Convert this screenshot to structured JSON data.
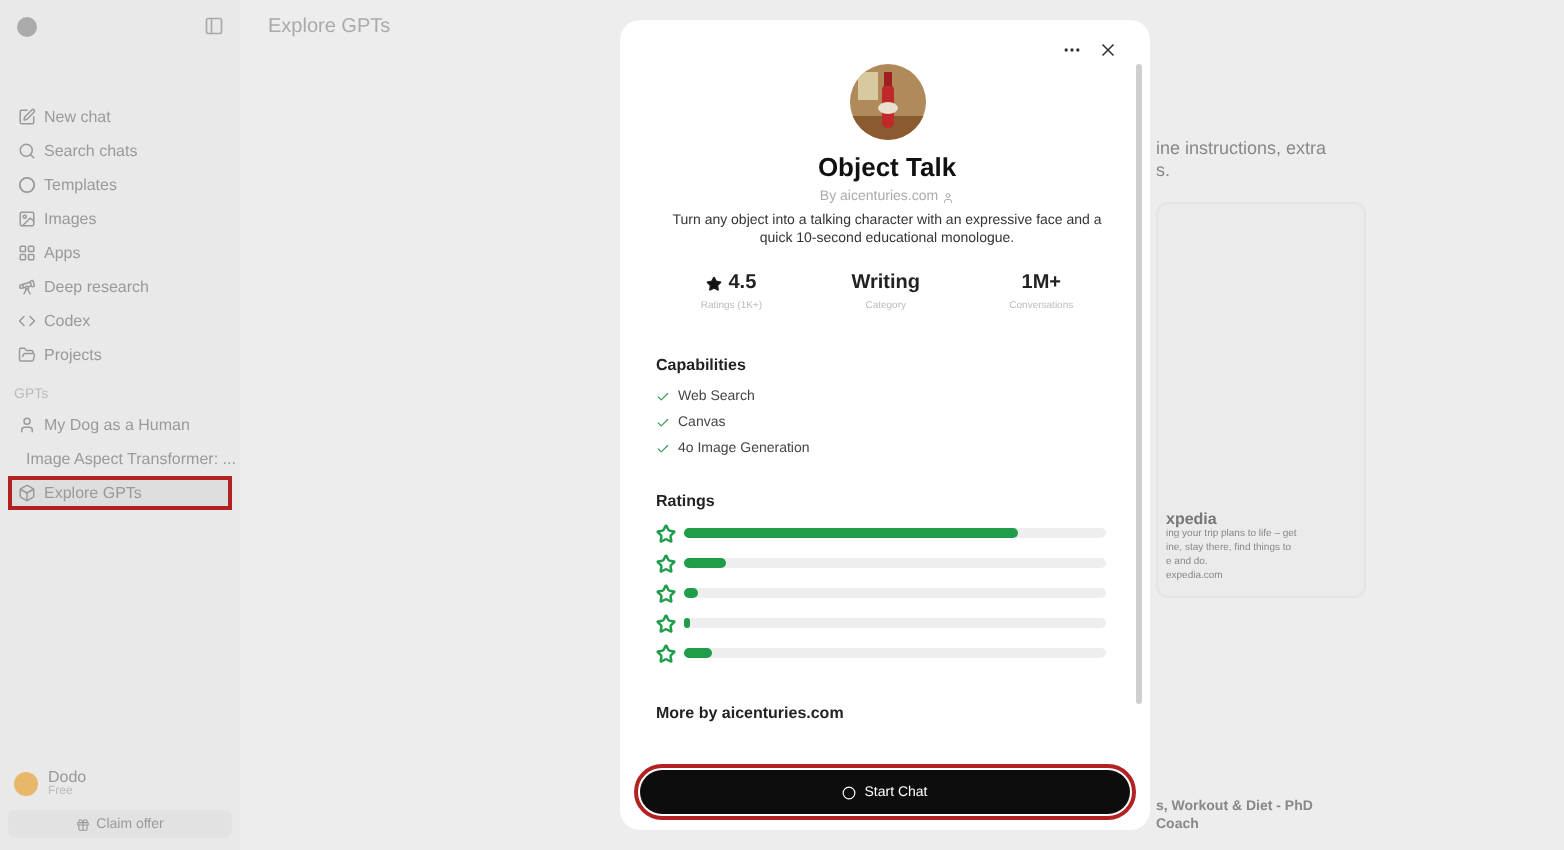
{
  "sidebar": {
    "nav": [
      {
        "label": "New chat"
      },
      {
        "label": "Search chats"
      },
      {
        "label": "Templates"
      },
      {
        "label": "Images"
      },
      {
        "label": "Apps"
      },
      {
        "label": "Deep research"
      },
      {
        "label": "Codex"
      },
      {
        "label": "Projects"
      }
    ],
    "section": "GPTs",
    "gpts": [
      {
        "label": "My Dog as a Human",
        "highlighted": false
      },
      {
        "label": "Image Aspect Transformer: ...",
        "highlighted": false
      },
      {
        "label": "Explore GPTs",
        "highlighted": true
      }
    ],
    "user": {
      "name": "Dodo",
      "plan": "Free"
    },
    "claim": "Claim offer"
  },
  "page": {
    "title": "Explore GPTs",
    "intro": [
      "ine instructions, extra",
      "s."
    ],
    "card": {
      "title": "xpedia",
      "lines": [
        "ing your trip plans to life – get",
        "ine, stay there, find things to",
        "e and do."
      ],
      "domain": "expedia.com"
    },
    "bottom_right": [
      "s, Workout & Diet - PhD",
      "Coach"
    ]
  },
  "modal": {
    "name": "Object Talk",
    "author": "By aicenturies.com",
    "description": "Turn any object into a talking character with an expressive face and a quick 10-second educational monologue.",
    "stats": [
      {
        "value": "4.5",
        "label": "Ratings (1K+)",
        "kind": "rating"
      },
      {
        "value": "Writing",
        "label": "Category",
        "kind": "plain"
      },
      {
        "value": "1M+",
        "label": "Conversations",
        "kind": "plain"
      }
    ],
    "capabilities_title": "Capabilities",
    "capabilities": [
      "Web Search",
      "Canvas",
      "4o Image Generation"
    ],
    "ratings_title": "Ratings",
    "ratings": [
      {
        "level": 0.79
      },
      {
        "level": 0.1
      },
      {
        "level": 0.035
      },
      {
        "level": 0.015
      },
      {
        "level": 0.065
      }
    ],
    "more_title": "More by aicenturies.com",
    "start": {
      "label": "Start Chat",
      "highlighted": true
    }
  }
}
